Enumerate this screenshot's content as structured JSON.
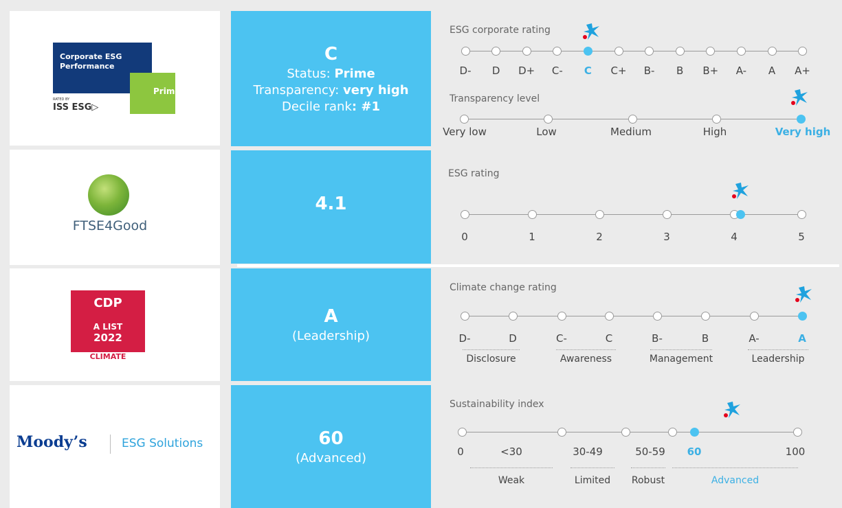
{
  "brand": {
    "accent": "#4cc3f1",
    "accent_text": "#3cb0e4",
    "star_icon": "caixabank-star-icon"
  },
  "rows": [
    {
      "logo": {
        "line1": "Corporate ESG",
        "line2": "Performance",
        "badge": "Prime",
        "rated_by": "RATED BY",
        "brand": "ISS ESG▷"
      },
      "main_value": "C",
      "lines": [
        {
          "label": "Status: ",
          "value": "Prime"
        },
        {
          "label": "Transparency: ",
          "value": "very high"
        },
        {
          "label": "Decile rank",
          "value": ": #1"
        }
      ]
    },
    {
      "logo": {
        "name": "FTSE4Good"
      },
      "main_value": "4.1"
    },
    {
      "logo": {
        "brand": "CDP",
        "list": "A LIST",
        "year": "2022",
        "category": "CLIMATE"
      },
      "main_value": "A",
      "sub": "(Leadership)"
    },
    {
      "logo": {
        "brand": "Moody’s",
        "product": "ESG Solutions"
      },
      "main_value": "60",
      "sub": "(Advanced)"
    }
  ],
  "scales": {
    "esg_corporate": {
      "title": "ESG corporate rating",
      "labels": [
        "D-",
        "D",
        "D+",
        "C-",
        "C",
        "C+",
        "B-",
        "B",
        "B+",
        "A-",
        "A",
        "A+"
      ],
      "active_index": 4
    },
    "transparency": {
      "title": "Transparency level",
      "labels": [
        "Very low",
        "Low",
        "Medium",
        "High",
        "Very high"
      ],
      "active_index": 4
    },
    "ftse": {
      "title": "ESG rating",
      "labels": [
        "0",
        "1",
        "2",
        "3",
        "4",
        "5"
      ],
      "value": 4.1
    },
    "cdp": {
      "title": "Climate change rating",
      "labels": [
        "D-",
        "D",
        "C-",
        "C",
        "B-",
        "B",
        "A-",
        "A"
      ],
      "groups": [
        "Disclosure",
        "Awareness",
        "Management",
        "Leadership"
      ],
      "active_index": 7,
      "active_group": 3
    },
    "moodys": {
      "title": "Sustainability index",
      "labels": [
        "0",
        "<30",
        "30-49",
        "50-59",
        "60",
        "100"
      ],
      "groups": [
        "Weak",
        "Limited",
        "Robust",
        "Advanced"
      ],
      "active_label": 4,
      "active_group": 3
    }
  }
}
